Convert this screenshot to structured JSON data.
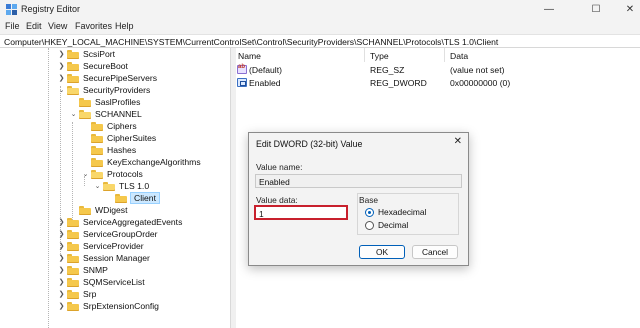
{
  "window": {
    "title": "Registry Editor",
    "minimize_glyph": "—",
    "maximize_glyph": "☐",
    "close_glyph": "✕"
  },
  "menu": [
    "File",
    "Edit",
    "View",
    "Favorites",
    "Help"
  ],
  "address": "Computer\\HKEY_LOCAL_MACHINE\\SYSTEM\\CurrentControlSet\\Control\\SecurityProviders\\SCHANNEL\\Protocols\\TLS 1.0\\Client",
  "tree": [
    {
      "label": "ScsiPort",
      "expandable": true,
      "expanded": false
    },
    {
      "label": "SecureBoot",
      "expandable": true,
      "expanded": false
    },
    {
      "label": "SecurePipeServers",
      "expandable": true,
      "expanded": false
    },
    {
      "label": "SecurityProviders",
      "expandable": true,
      "expanded": true
    },
    {
      "label": "SaslProfiles",
      "expandable": false,
      "expanded": false
    },
    {
      "label": "SCHANNEL",
      "expandable": true,
      "expanded": true
    },
    {
      "label": "Ciphers",
      "expandable": false,
      "expanded": false
    },
    {
      "label": "CipherSuites",
      "expandable": false,
      "expanded": false
    },
    {
      "label": "Hashes",
      "expandable": false,
      "expanded": false
    },
    {
      "label": "KeyExchangeAlgorithms",
      "expandable": false,
      "expanded": false
    },
    {
      "label": "Protocols",
      "expandable": true,
      "expanded": true
    },
    {
      "label": "TLS 1.0",
      "expandable": true,
      "expanded": true
    },
    {
      "label": "Client",
      "expandable": false,
      "expanded": false,
      "selected": true
    },
    {
      "label": "WDigest",
      "expandable": false,
      "expanded": false
    },
    {
      "label": "ServiceAggregatedEvents",
      "expandable": true,
      "expanded": false
    },
    {
      "label": "ServiceGroupOrder",
      "expandable": true,
      "expanded": false
    },
    {
      "label": "ServiceProvider",
      "expandable": true,
      "expanded": false
    },
    {
      "label": "Session Manager",
      "expandable": true,
      "expanded": false
    },
    {
      "label": "SNMP",
      "expandable": true,
      "expanded": false
    },
    {
      "label": "SQMServiceList",
      "expandable": true,
      "expanded": false
    },
    {
      "label": "Srp",
      "expandable": true,
      "expanded": false
    },
    {
      "label": "SrpExtensionConfig",
      "expandable": true,
      "expanded": false
    }
  ],
  "values_table": {
    "headers": {
      "name": "Name",
      "type": "Type",
      "data": "Data"
    },
    "rows": [
      {
        "icon": "string-value-icon",
        "name": "(Default)",
        "type": "REG_SZ",
        "data": "(value not set)"
      },
      {
        "icon": "dword-value-icon",
        "name": "Enabled",
        "type": "REG_DWORD",
        "data": "0x00000000 (0)"
      }
    ]
  },
  "dialog": {
    "title": "Edit DWORD (32-bit) Value",
    "close_glyph": "✕",
    "value_name_label": "Value name:",
    "value_name": "Enabled",
    "value_data_label": "Value data:",
    "value_data": "1",
    "base_label": "Base",
    "base_options": [
      {
        "label": "Hexadecimal",
        "checked": true
      },
      {
        "label": "Decimal",
        "checked": false
      }
    ],
    "ok_label": "OK",
    "cancel_label": "Cancel"
  },
  "colors": {
    "highlight_border": "#c8202d",
    "selection": "#cce8ff",
    "accent": "#005fb8"
  }
}
